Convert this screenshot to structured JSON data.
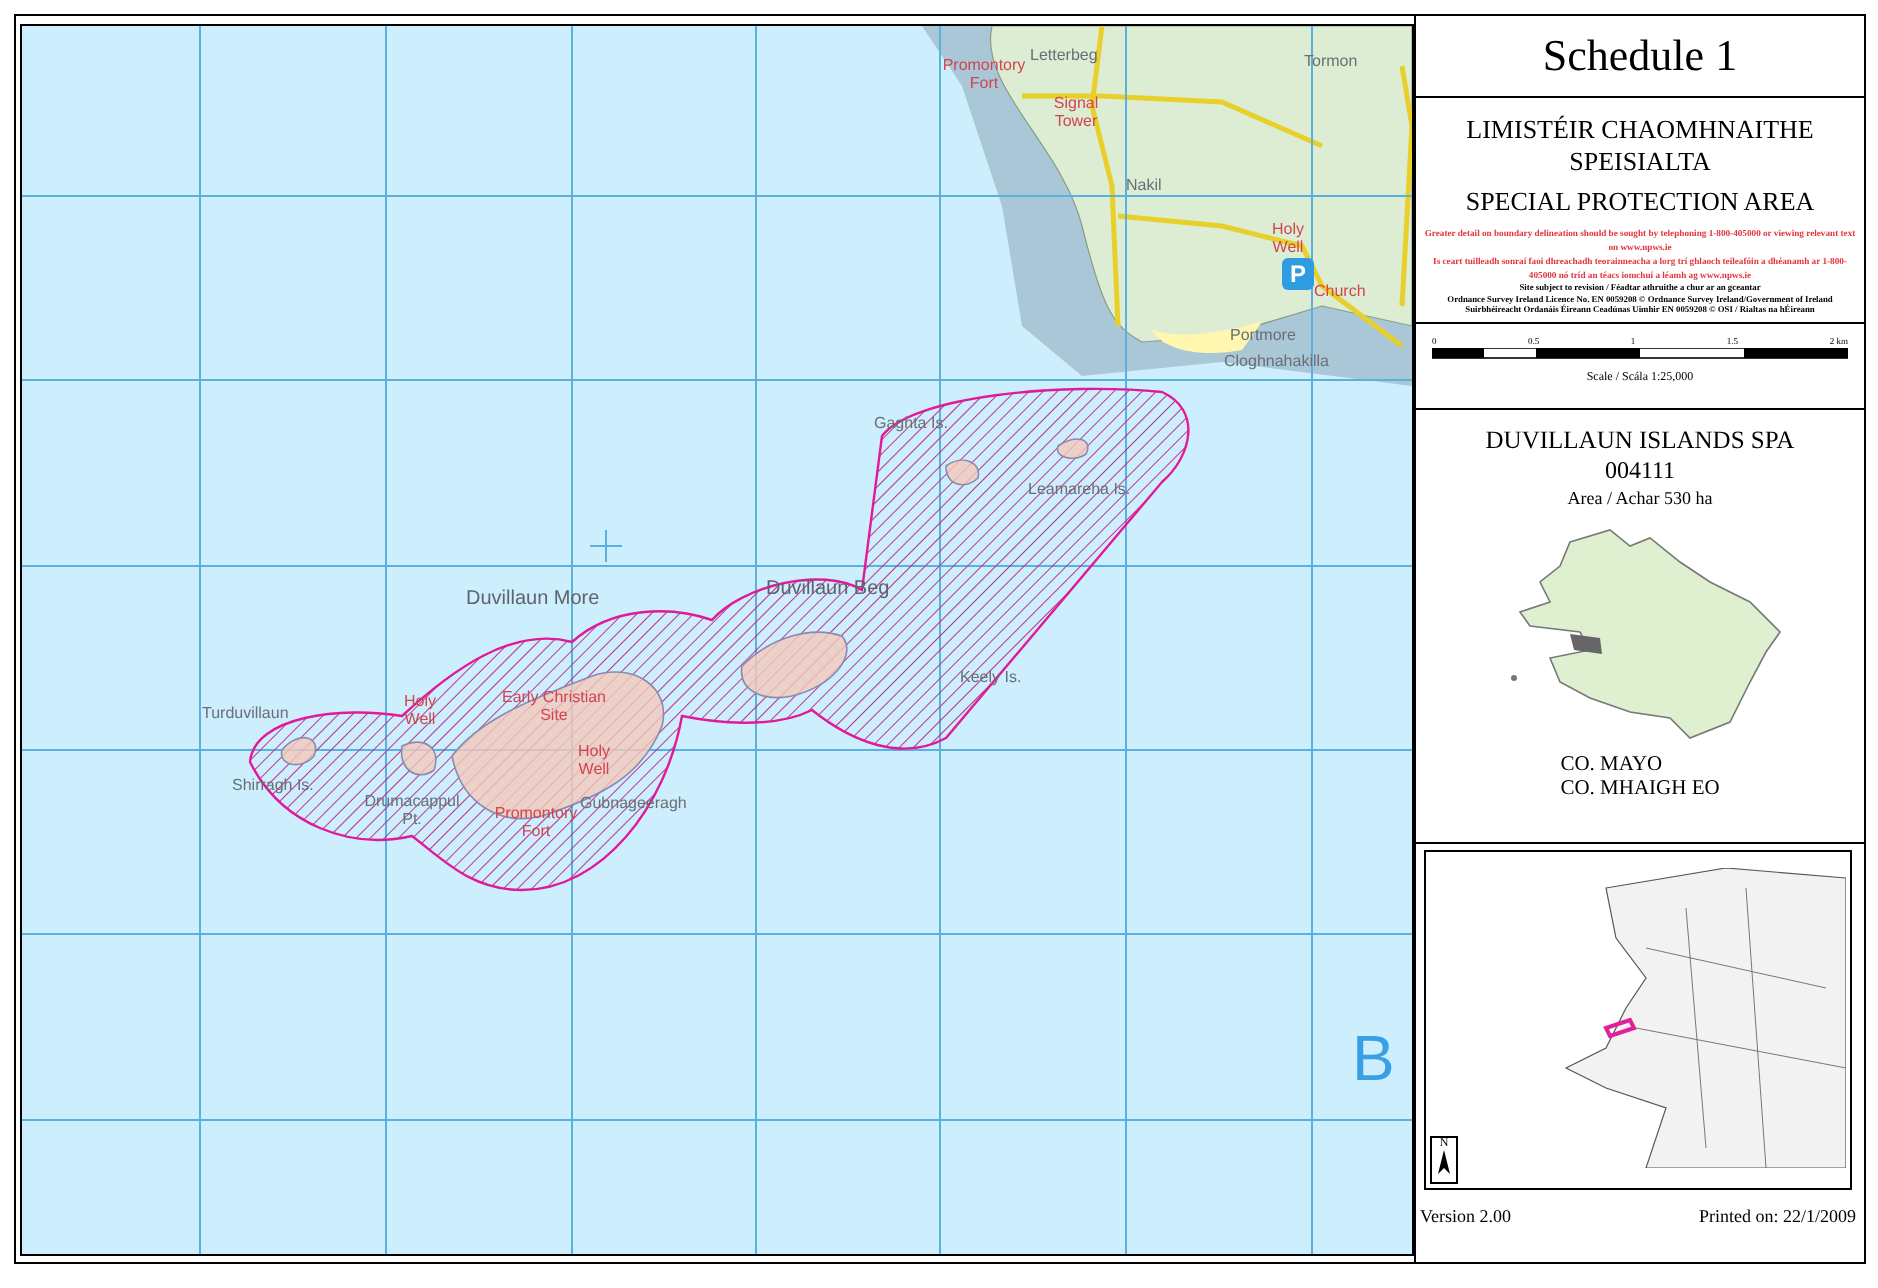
{
  "map": {
    "labels": [
      {
        "text": "Promontory Fort",
        "kind": "feature"
      },
      {
        "text": "Letterbeg",
        "kind": "place"
      },
      {
        "text": "Tormon",
        "kind": "place"
      },
      {
        "text": "Signal Tower",
        "kind": "feature"
      },
      {
        "text": "Nakil",
        "kind": "place"
      },
      {
        "text": "Holy Well",
        "kind": "feature"
      },
      {
        "text": "P",
        "kind": "parking"
      },
      {
        "text": "Church",
        "kind": "feature"
      },
      {
        "text": "Portmore",
        "kind": "place"
      },
      {
        "text": "Cloghnahakilla",
        "kind": "place"
      },
      {
        "text": "Gaghta Is.",
        "kind": "place"
      },
      {
        "text": "Leamareha Is.",
        "kind": "place"
      },
      {
        "text": "Duvillaun More",
        "kind": "island"
      },
      {
        "text": "Duvillaun Beg",
        "kind": "island"
      },
      {
        "text": "Keely Is.",
        "kind": "place"
      },
      {
        "text": "Turduvillaun",
        "kind": "place"
      },
      {
        "text": "Holy Well",
        "kind": "feature"
      },
      {
        "text": "Early Christian Site",
        "kind": "feature"
      },
      {
        "text": "Holy Well",
        "kind": "feature"
      },
      {
        "text": "Shirragh Is.",
        "kind": "place"
      },
      {
        "text": "Drumacappul Pt.",
        "kind": "place"
      },
      {
        "text": "Promontory Fort",
        "kind": "feature"
      },
      {
        "text": "Gubnageeragh",
        "kind": "place"
      },
      {
        "text": "B",
        "kind": "sheet"
      }
    ]
  },
  "panel": {
    "schedule": "Schedule 1",
    "title_irish": "LIMISTÉIR CHAOMHNAITHE SPEISIALTA",
    "title_english": "SPECIAL PROTECTION AREA",
    "warnings": [
      "Greater detail on boundary delineation should be sought by telephoning 1-800-405000 or viewing relevant text on www.npws.ie",
      "Is ceart tuilleadh sonraí faoi dhreachadh teorainneacha a lorg trí ghlaoch teileafóin a dhéanamh ar 1-800-405000 nó tríd an téacs iomchuí a léamh ag www.npws.ie"
    ],
    "notes": [
      "Site subject to revision / Féadtar athruithe a chur ar an gceantar",
      "Ordnance Survey Ireland Licence No. EN 0059208 © Ordnance Survey Ireland/Government of Ireland",
      "Suirbhéireacht Ordanáis Éireann Ceadúnas Uimhir EN 0059208 © OSI / Rialtas na hÉireann"
    ],
    "scale": {
      "ticks": [
        "0",
        "0.5",
        "1",
        "1.5",
        "2 km"
      ],
      "caption": "Scale / Scála 1:25,000"
    },
    "site": {
      "name": "DUVILLAUN ISLANDS SPA",
      "code": "004111",
      "area": "Area / Achar 530 ha"
    },
    "county": [
      "CO. MAYO",
      "CO. MHAIGH EO"
    ],
    "locator": {
      "north": "N"
    },
    "footer": {
      "version": "Version 2.00",
      "printed": "Printed on: 22/1/2009"
    }
  }
}
